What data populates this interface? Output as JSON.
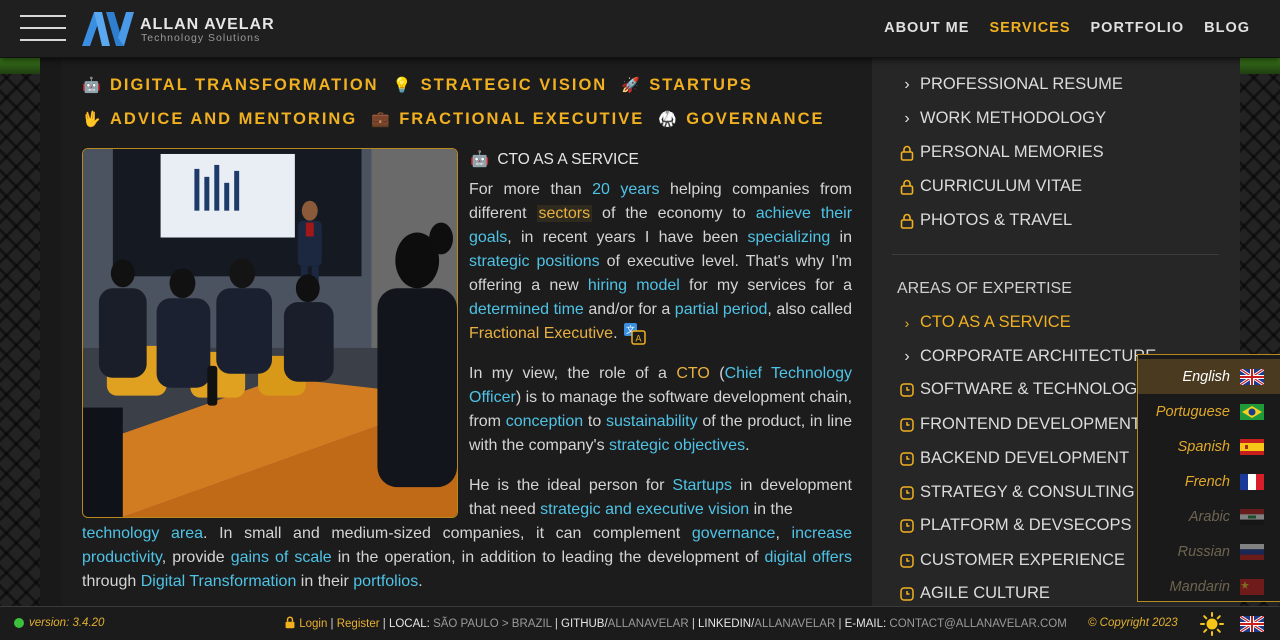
{
  "header": {
    "logo_name": "ALLAN AVELAR",
    "logo_sub": "Technology Solutions",
    "nav": [
      {
        "label": "ABOUT ME",
        "active": false
      },
      {
        "label": "SERVICES",
        "active": true
      },
      {
        "label": "PORTFOLIO",
        "active": false
      },
      {
        "label": "BLOG",
        "active": false
      }
    ]
  },
  "categories": {
    "row1": [
      {
        "icon": "robot-icon",
        "glyph": "🤖",
        "label": "DIGITAL TRANSFORMATION"
      },
      {
        "icon": "lightbulb-icon",
        "glyph": "💡",
        "label": "STRATEGIC VISION"
      },
      {
        "icon": "rocket-icon",
        "glyph": "🚀",
        "label": "STARTUPS"
      }
    ],
    "row2": [
      {
        "icon": "hand-icon",
        "glyph": "🖖",
        "label": "ADVICE AND MENTORING"
      },
      {
        "icon": "briefcase-icon",
        "glyph": "💼",
        "label": "FRACTIONAL EXECUTIVE"
      },
      {
        "icon": "judge-icon",
        "glyph": "🥋",
        "label": "GOVERNANCE"
      }
    ]
  },
  "content": {
    "section_title": "CTO AS A SERVICE",
    "section_icon": "🤖",
    "p1": {
      "a": "For more than ",
      "years": "20 years",
      "b": " helping companies from different ",
      "sectors": "sectors",
      "c": " of the economy to ",
      "goals": "achieve their goals",
      "d": ", in recent years I have been ",
      "specializing": "specializing",
      "e": " in ",
      "strategic_positions": "strategic positions",
      "f": " of executive level. That's why I'm offering a new ",
      "hiring_model": "hiring model",
      "g": " for my services for a ",
      "determined_time": "determined time",
      "h": " and/or for a ",
      "partial_period": "partial period",
      "i": ", also called ",
      "fractional": "Fractional Executive",
      "j": "."
    },
    "p2": {
      "a": "In my view, the role of a ",
      "cto": "CTO",
      "b": " (",
      "full": "Chief Technology Officer",
      "c": ") is to manage the software development chain, from ",
      "conception": "conception",
      "d": " to ",
      "sustainability": "sustainability",
      "e": " of the product, in line with the company's ",
      "objectives": "strategic objectives",
      "f": "."
    },
    "p3_top": {
      "a": "He is the ideal person for ",
      "startups": "Startups",
      "b": " in development that need ",
      "strategic": "strategic and executive vision",
      "c": " in the"
    },
    "p3_bottom": {
      "area": "technology area",
      "a": ". In small and medium-sized companies, it can complement ",
      "governance": "governance",
      "b": ", ",
      "productivity": "increase productivity",
      "c": ", provide ",
      "scale": "gains of scale",
      "d": " in the operation, in addition to leading the development of ",
      "digital_offers": "digital offers",
      "e": " through ",
      "dt": "Digital Transformation",
      "f": " in their ",
      "portfolios": "portfolios",
      "g": "."
    }
  },
  "sidebar": {
    "top_items": [
      {
        "label": "PROFESSIONAL RESUME",
        "icon": "chevron-right-icon"
      },
      {
        "label": "WORK METHODOLOGY",
        "icon": "chevron-right-icon"
      },
      {
        "label": "PERSONAL MEMORIES",
        "icon": "lock-icon"
      },
      {
        "label": "CURRICULUM VITAE",
        "icon": "lock-icon"
      },
      {
        "label": "PHOTOS & TRAVEL",
        "icon": "lock-icon"
      }
    ],
    "heading": "AREAS OF EXPERTISE",
    "expertise": [
      {
        "label": "CTO AS A SERVICE",
        "icon": "chevron-right-icon",
        "active": true
      },
      {
        "label": "CORPORATE ARCHITECTURE",
        "icon": "chevron-right-icon",
        "active": false
      },
      {
        "label": "SOFTWARE & TECHNOLOGY",
        "icon": "clock-icon",
        "active": false
      },
      {
        "label": "FRONTEND DEVELOPMENT",
        "icon": "clock-icon",
        "active": false
      },
      {
        "label": "BACKEND DEVELOPMENT",
        "icon": "clock-icon",
        "active": false
      },
      {
        "label": "STRATEGY & CONSULTING",
        "icon": "clock-icon",
        "active": false
      },
      {
        "label": "PLATFORM & DEVSECOPS",
        "icon": "clock-icon",
        "active": false
      },
      {
        "label": "CUSTOMER EXPERIENCE",
        "icon": "clock-icon",
        "active": false
      },
      {
        "label": "AGILE CULTURE",
        "icon": "clock-icon",
        "active": false
      }
    ]
  },
  "languages": [
    {
      "label": "English",
      "flag": "uk-flag-icon",
      "state": "selected"
    },
    {
      "label": "Portuguese",
      "flag": "brazil-flag-icon",
      "state": "enabled"
    },
    {
      "label": "Spanish",
      "flag": "spain-flag-icon",
      "state": "enabled"
    },
    {
      "label": "French",
      "flag": "france-flag-icon",
      "state": "enabled"
    },
    {
      "label": "Arabic",
      "flag": "iraq-flag-icon",
      "state": "disabled"
    },
    {
      "label": "Russian",
      "flag": "russia-flag-icon",
      "state": "disabled"
    },
    {
      "label": "Mandarin",
      "flag": "china-flag-icon",
      "state": "disabled"
    }
  ],
  "footer": {
    "version": "version: 3.4.20",
    "login": "Login",
    "register": "Register",
    "local_label": "LOCAL:",
    "local_value": "SÃO PAULO > BRAZIL",
    "github_label": "GITHUB/",
    "github_value": "ALLANAVELAR",
    "linkedin_label": "LINKEDIN/",
    "linkedin_value": "ALLANAVELAR",
    "email_label": "E-MAIL:",
    "email_value": "CONTACT@ALLANAVELAR.COM",
    "copyright": "© Copyright 2023"
  },
  "colors": {
    "accent": "#f0b020",
    "link": "#4fc3e6",
    "background": "#1b1b1b"
  }
}
